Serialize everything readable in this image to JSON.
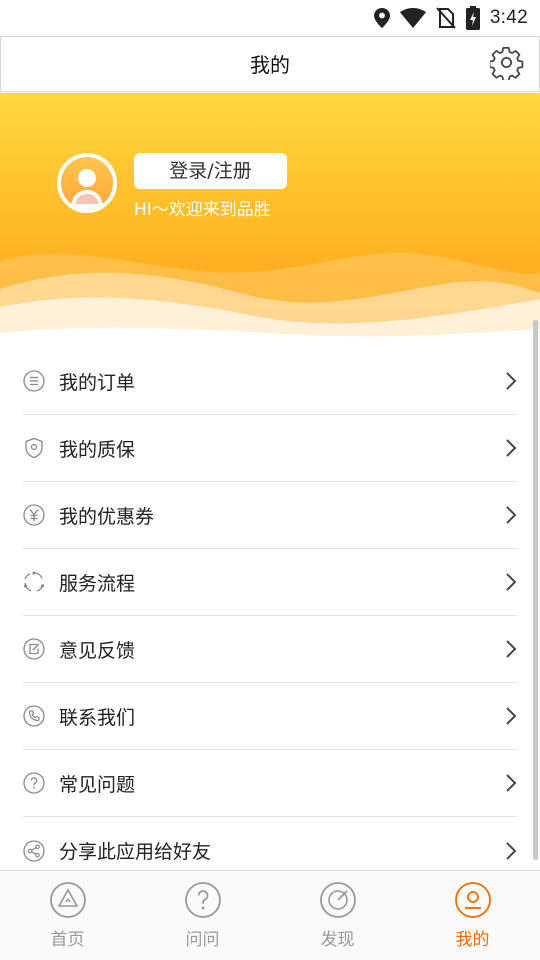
{
  "status_bar": {
    "time": "3:42",
    "icons": [
      "location-icon",
      "wifi-icon",
      "no-sim-icon",
      "battery-charging-icon"
    ]
  },
  "header": {
    "title": "我的",
    "settings_icon": "gear-icon"
  },
  "profile": {
    "login_label": "登录/注册",
    "welcome": "HI～欢迎来到品胜",
    "avatar_icon": "user-avatar-icon"
  },
  "menu": {
    "items": [
      {
        "label": "我的订单",
        "icon": "order-list-icon"
      },
      {
        "label": "我的质保",
        "icon": "shield-icon"
      },
      {
        "label": "我的优惠券",
        "icon": "yen-coupon-icon"
      },
      {
        "label": "服务流程",
        "icon": "process-cycle-icon"
      },
      {
        "label": "意见反馈",
        "icon": "edit-feedback-icon"
      },
      {
        "label": "联系我们",
        "icon": "phone-icon"
      },
      {
        "label": "常见问题",
        "icon": "question-icon"
      },
      {
        "label": "分享此应用给好友",
        "icon": "share-icon"
      }
    ]
  },
  "bottom_nav": {
    "items": [
      {
        "label": "首页",
        "icon": "home-triangle-icon",
        "active": false
      },
      {
        "label": "问问",
        "icon": "question-circle-icon",
        "active": false
      },
      {
        "label": "发现",
        "icon": "discover-compass-icon",
        "active": false
      },
      {
        "label": "我的",
        "icon": "profile-icon",
        "active": true
      }
    ]
  },
  "colors": {
    "accent": "#ef6c00",
    "banner_top": "#ffd73f",
    "banner_bottom": "#ff9d17"
  }
}
